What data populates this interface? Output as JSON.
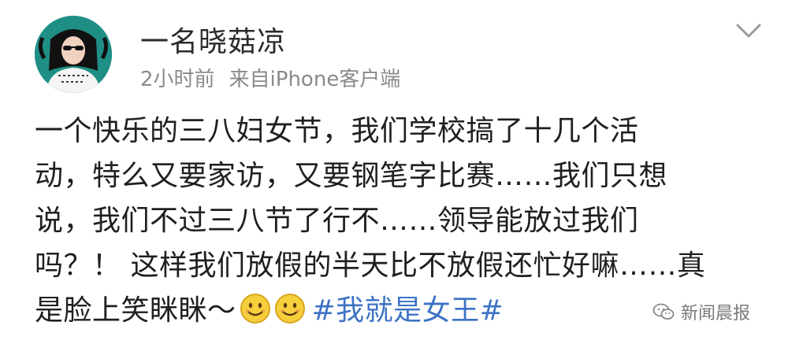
{
  "post": {
    "username": "一名晓菇凉",
    "time": "2小时前",
    "source": "来自iPhone客户端",
    "content_lines": [
      "一个快乐的三八妇女节，我们学校搞了十几个活",
      "动，特么又要家访，又要钢笔字比赛……我们只想",
      "说，我们不过三八节了行不……领导能放过我们",
      "吗？！ 这样我们放假的半天比不放假还忙好嘛……真",
      "是脸上笑眯眯～"
    ],
    "hashtag": "#我就是女王#",
    "emojis": [
      "smile-emoji",
      "smile-emoji"
    ]
  },
  "watermark": {
    "text": "新闻晨报"
  },
  "icons": {
    "menu": "chevron-down-icon",
    "watermark": "wechat-icon"
  },
  "colors": {
    "text": "#1f1f1f",
    "meta": "#8a8a8a",
    "hashtag": "#3d73c4",
    "avatar_bg": "#1f8f86"
  }
}
